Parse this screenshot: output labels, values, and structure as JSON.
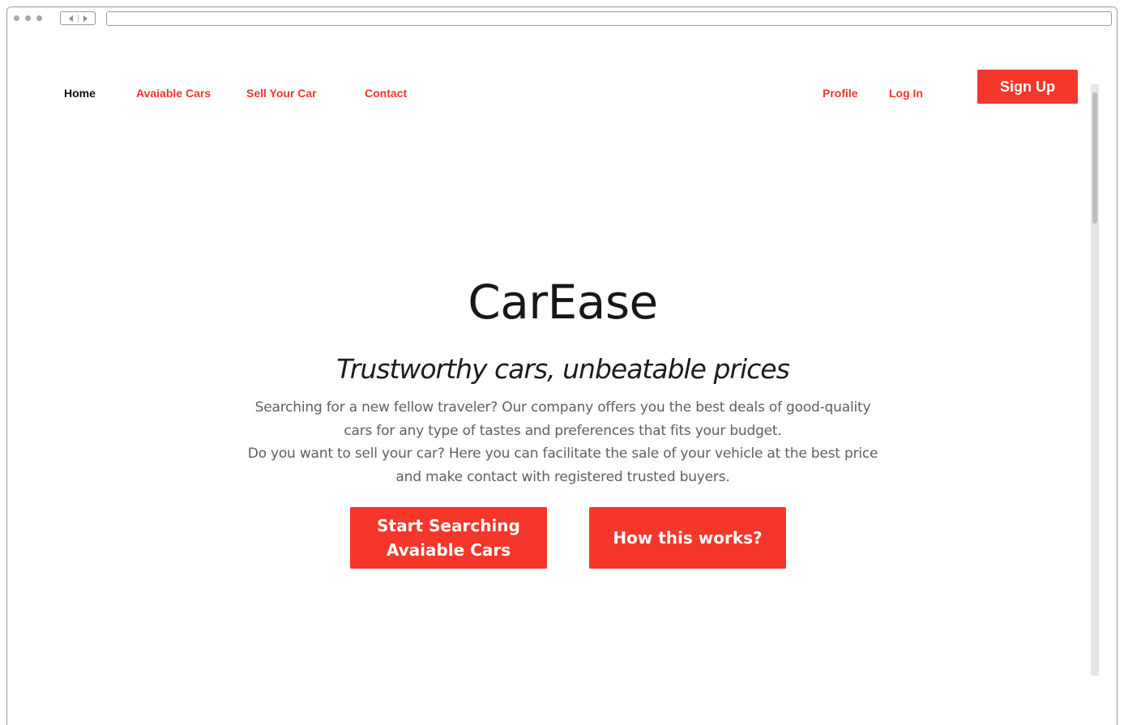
{
  "nav": {
    "home": "Home",
    "available_cars": "Avaiable Cars",
    "sell_your_car": "Sell Your Car",
    "contact": "Contact",
    "profile": "Profile",
    "log_in": "Log In",
    "sign_up": "Sign Up"
  },
  "hero": {
    "brand": "CarEase",
    "tagline": "Trustworthy cars, unbeatable prices",
    "description_lines": [
      "Searching for a new fellow traveler? Our company offers you the best deals of good-quality",
      "cars for any type of tastes and preferences that fits your budget.",
      "Do you want to sell your car? Here you can facilitate the sale of your vehicle at the best price",
      "and make contact with registered trusted buyers."
    ],
    "cta_start_line1": "Start Searching",
    "cta_start_line2": "Avaiable Cars",
    "cta_how": "How this works?"
  },
  "colors": {
    "accent": "#f5362a",
    "text_dark": "#171717",
    "text_muted": "#5f5f5f"
  }
}
